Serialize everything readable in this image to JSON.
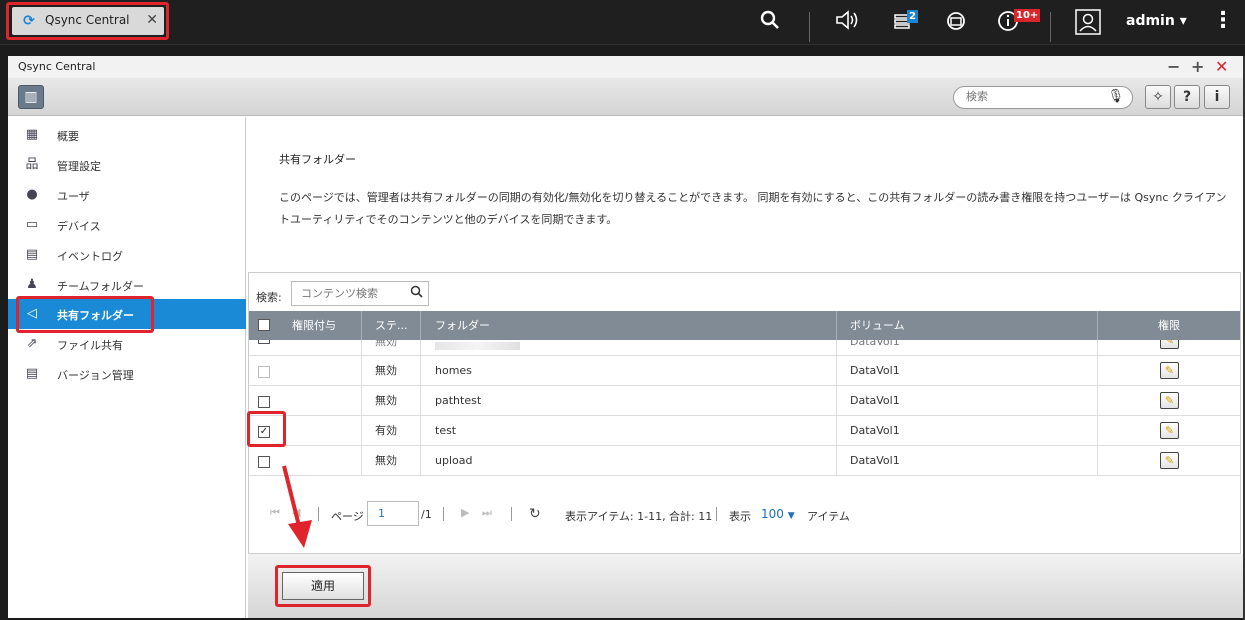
{
  "taskbar": {
    "tab_title": "Qsync Central",
    "notification_count": "2",
    "info_count": "10+",
    "user": "admin"
  },
  "window": {
    "title": "Qsync Central",
    "search_placeholder": "検索"
  },
  "sidebar": {
    "items": [
      {
        "label": "概要",
        "icon": "overview-icon"
      },
      {
        "label": "管理設定",
        "icon": "management-settings-icon"
      },
      {
        "label": "ユーザ",
        "icon": "user-icon"
      },
      {
        "label": "デバイス",
        "icon": "device-icon"
      },
      {
        "label": "イベントログ",
        "icon": "event-log-icon"
      },
      {
        "label": "チームフォルダー",
        "icon": "team-folder-icon"
      },
      {
        "label": "共有フォルダー",
        "icon": "shared-folder-icon",
        "active": true
      },
      {
        "label": "ファイル共有",
        "icon": "file-sharing-icon"
      },
      {
        "label": "バージョン管理",
        "icon": "version-control-icon"
      }
    ]
  },
  "main": {
    "heading": "共有フォルダー",
    "description": "このページでは、管理者は共有フォルダーの同期の有効化/無効化を切り替えることができます。 同期を有効にすると、この共有フォルダーの読み書き権限を持つユーザーは Qsync クライアントユーティリティでそのコンテンツと他のデバイスを同期できます。",
    "search_label": "検索:",
    "search_placeholder": "コンテンツ検索",
    "columns": [
      "権限付与",
      "ステ...",
      "フォルダー",
      "ボリューム",
      "権限"
    ],
    "rows": [
      {
        "checked": false,
        "disabled": false,
        "status": "無効",
        "folder": "",
        "volume": "DataVol1",
        "partial": true
      },
      {
        "checked": false,
        "disabled": true,
        "status": "無効",
        "folder": "homes",
        "volume": "DataVol1"
      },
      {
        "checked": false,
        "disabled": false,
        "status": "無効",
        "folder": "pathtest",
        "volume": "DataVol1"
      },
      {
        "checked": true,
        "disabled": false,
        "status": "有効",
        "folder": "test",
        "volume": "DataVol1"
      },
      {
        "checked": false,
        "disabled": false,
        "status": "無効",
        "folder": "upload",
        "volume": "DataVol1"
      }
    ],
    "pager": {
      "page_label": "ページ",
      "page_value": "1",
      "page_total": "/1",
      "display_items": "表示アイテム: 1-11, 合計: 11",
      "display_label": "表示",
      "per_page": "100",
      "items_label": "アイテム"
    },
    "apply_label": "適用"
  },
  "colors": {
    "accent": "#1b8ad6",
    "highlight": "#e0242b",
    "table_header": "#818b95"
  }
}
